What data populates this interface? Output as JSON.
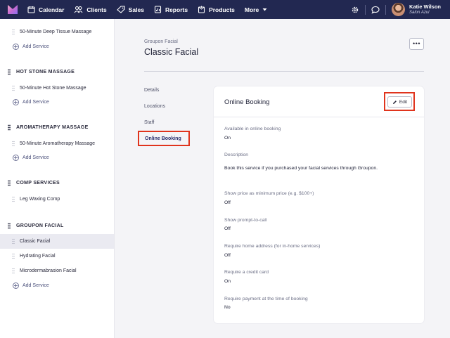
{
  "nav": {
    "items": [
      {
        "label": "Calendar",
        "icon": "calendar-icon"
      },
      {
        "label": "Clients",
        "icon": "clients-icon"
      },
      {
        "label": "Sales",
        "icon": "sales-tag-icon"
      },
      {
        "label": "Reports",
        "icon": "reports-icon"
      },
      {
        "label": "Products",
        "icon": "products-icon"
      },
      {
        "label": "More",
        "icon": "chevron-down-icon"
      }
    ],
    "user": {
      "name": "Katie Wilson",
      "business": "Salon Azul"
    },
    "colors": {
      "bar": "#222851",
      "accent": "#e0341d"
    }
  },
  "sidebar": {
    "add_label": "Add Service",
    "services": {
      "deep_tissue": "50-Minute Deep Tissue Massage",
      "hot_stone": "50-Minute Hot Stone Massage",
      "aromatherapy": "50-Minute Aromatherapy Massage",
      "leg_waxing": "Leg Waxing Comp",
      "classic_facial": "Classic Facial",
      "hydrating_facial": "Hydrating Facial",
      "microderm": "Microdermabrasion Facial"
    },
    "groups": {
      "hot_stone": "HOT STONE MASSAGE",
      "aromatherapy": "AROMATHERAPY MASSAGE",
      "comp": "COMP SERVICES",
      "groupon": "GROUPON FACIAL"
    }
  },
  "main": {
    "subtitle": "Groupon Facial",
    "title": "Classic Facial",
    "more_label": "•••",
    "subnav": {
      "details": "Details",
      "locations": "Locations",
      "staff": "Staff",
      "online_booking": "Online Booking"
    },
    "card": {
      "title": "Online Booking",
      "edit_label": "Edit",
      "fields": {
        "available_label": "Available in online booking",
        "available_value": "On",
        "description_label": "Description",
        "description_value": "Book this service if you purchased your facial services through Groupon.",
        "min_price_label": "Show price as minimum price (e.g. $100+)",
        "min_price_value": "Off",
        "prompt_call_label": "Show prompt-to-call",
        "prompt_call_value": "Off",
        "home_address_label": "Require home address (for in-home services)",
        "home_address_value": "Off",
        "credit_card_label": "Require a credit card",
        "credit_card_value": "On",
        "payment_label": "Require payment at the time of booking",
        "payment_value": "No"
      }
    }
  }
}
